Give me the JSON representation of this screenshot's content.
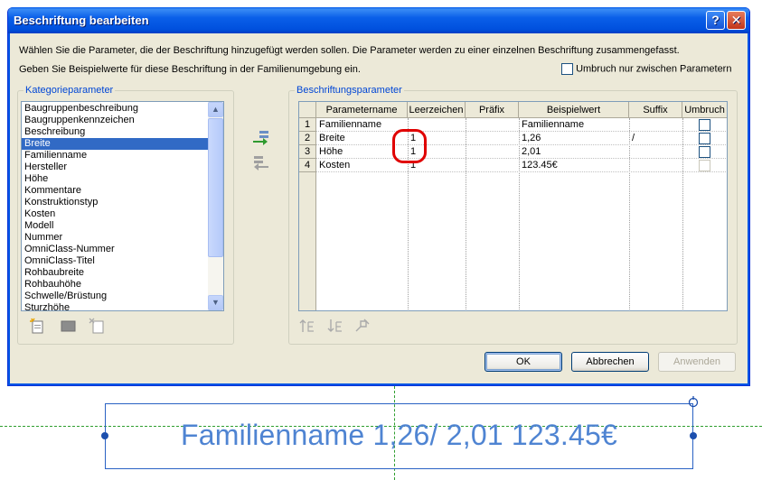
{
  "dialog": {
    "title": "Beschriftung bearbeiten",
    "help_label": "?",
    "close_label": "✕",
    "description_line1": "Wählen Sie die Parameter, die der Beschriftung hinzugefügt werden sollen. Die Parameter werden zu einer einzelnen Beschriftung zusammengefasst.",
    "description_line2": "Geben Sie Beispielwerte für diese Beschriftung in der Familienumgebung ein.",
    "wrap_option_label": "Umbruch nur zwischen Parametern",
    "wrap_option_checked": false
  },
  "category": {
    "group_label": "Kategorieparameter",
    "items": [
      "Baugruppenbeschreibung",
      "Baugruppenkennzeichen",
      "Beschreibung",
      "Breite",
      "Familienname",
      "Hersteller",
      "Höhe",
      "Kommentare",
      "Konstruktionstyp",
      "Kosten",
      "Modell",
      "Nummer",
      "OmniClass-Nummer",
      "OmniClass-Titel",
      "Rohbaubreite",
      "Rohbauhöhe",
      "Schwelle/Brüstung",
      "Sturzhöhe"
    ],
    "selected_index": 3,
    "icons": [
      "new-parameter-icon",
      "edit-parameter-icon",
      "delete-parameter-icon"
    ]
  },
  "transfer": {
    "icons": [
      "add-to-label-icon",
      "remove-from-label-icon"
    ]
  },
  "label_params": {
    "group_label": "Beschriftungsparameter",
    "columns": [
      "Parametername",
      "Leerzeichen",
      "Präfix",
      "Beispielwert",
      "Suffix",
      "Umbruch"
    ],
    "rows": [
      {
        "num": "1",
        "name": "Familienname",
        "spaces": "",
        "prefix": "",
        "sample": "Familienname",
        "suffix": "",
        "wrap_enabled": true
      },
      {
        "num": "2",
        "name": "Breite",
        "spaces": "1",
        "prefix": "",
        "sample": "1,26",
        "suffix": "/",
        "wrap_enabled": true
      },
      {
        "num": "3",
        "name": "Höhe",
        "spaces": "1",
        "prefix": "",
        "sample": "2,01",
        "suffix": "",
        "wrap_enabled": true
      },
      {
        "num": "4",
        "name": "Kosten",
        "spaces": "1",
        "prefix": "",
        "sample": "123.45€",
        "suffix": "",
        "wrap_enabled": false
      }
    ],
    "icons": [
      "move-up-icon",
      "move-down-icon",
      "format-parameter-icon"
    ],
    "highlight_color": "#e00000"
  },
  "buttons": {
    "ok": "OK",
    "cancel": "Abbrechen",
    "apply": "Anwenden"
  },
  "preview": {
    "text": "Familienname 1,26/ 2,01 123.45€",
    "text_color": "#4f84d2",
    "frame_color": "#2a62c4",
    "reference_line_color": "#2e9e2e"
  }
}
